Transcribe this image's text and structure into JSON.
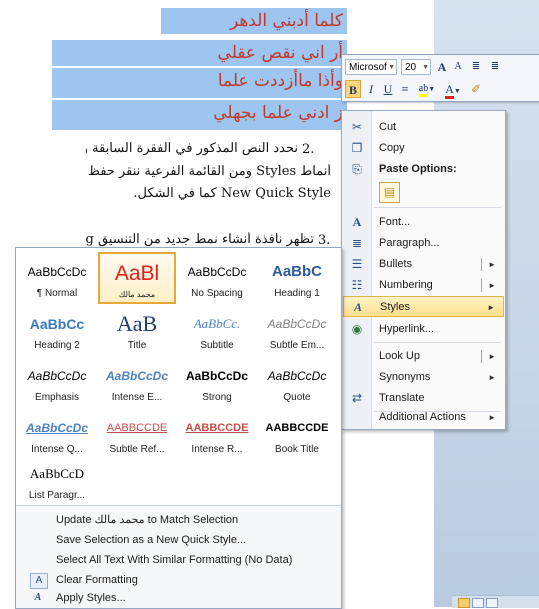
{
  "document": {
    "highlighted_lines": [
      "كلما أدبني الدهر",
      "أر اني نقص عقلي",
      "وأذا ماأزددت علما",
      "ز ادني علما بجهلي"
    ],
    "paragraph2": {
      "number": "2.",
      "line1": "نحدد النص المذكور في الفقرة السابقة وننقر بز",
      "line2": "أنماط Styles ومن القائمة الفرعية ننقر حفظ",
      "line3": "New Quick Style كما في الشكل."
    },
    "paragraph3": {
      "number": "3.",
      "line1": "تظهر نافذة أنشاء نمط جديد من التنسيق ting"
    }
  },
  "mini_toolbar": {
    "font_name": "Microsof",
    "font_size": "20",
    "grow_font": "A",
    "shrink_font": "A",
    "bold": "B",
    "italic": "I",
    "underline": "U",
    "center": "≡",
    "highlight": "ab",
    "font_color": "A",
    "format_painter": "✐"
  },
  "context_menu": {
    "items": [
      {
        "label": "Cut",
        "icon": "scissors-icon",
        "glyph": "✂"
      },
      {
        "label": "Copy",
        "icon": "copy-icon",
        "glyph": "❐"
      },
      {
        "label": "Font...",
        "icon": "font-icon",
        "glyph": "A"
      },
      {
        "label": "Paragraph...",
        "icon": "paragraph-icon",
        "glyph": "≣"
      },
      {
        "label": "Bullets",
        "icon": "bullets-icon",
        "glyph": "☰"
      },
      {
        "label": "Numbering",
        "icon": "numbering-icon",
        "glyph": "☷"
      },
      {
        "label": "Styles",
        "icon": "styles-icon",
        "glyph": "A"
      },
      {
        "label": "Hyperlink...",
        "icon": "hyperlink-icon",
        "glyph": "◉"
      },
      {
        "label": "Look Up",
        "icon": "",
        "glyph": ""
      },
      {
        "label": "Synonyms",
        "icon": "",
        "glyph": ""
      },
      {
        "label": "Translate",
        "icon": "translate-icon",
        "glyph": "⇄"
      },
      {
        "label": "Additional Actions",
        "icon": "",
        "glyph": ""
      }
    ],
    "paste_options_header": "Paste Options:",
    "paste_glyph": "📋",
    "submenu_arrow": "►",
    "highlight_color": "#ffe08a"
  },
  "styles_gallery": {
    "tiles": [
      {
        "preview": "AaBbCcDc",
        "name": "¶ Normal"
      },
      {
        "preview": "AaBl",
        "name": "محمد مالك"
      },
      {
        "preview": "AaBbCcDc",
        "name": "No Spacing"
      },
      {
        "preview": "AaBbC",
        "name": "Heading 1"
      },
      {
        "preview": "AaBbCc",
        "name": "Heading 2"
      },
      {
        "preview": "AaB",
        "name": "Title"
      },
      {
        "preview": "AaBbCc.",
        "name": "Subtitle"
      },
      {
        "preview": "AaBbCcDc",
        "name": "Subtle Em..."
      },
      {
        "preview": "AaBbCcDc",
        "name": "Emphasis"
      },
      {
        "preview": "AaBbCcDc",
        "name": "Intense E..."
      },
      {
        "preview": "AaBbCcDc",
        "name": "Strong"
      },
      {
        "preview": "AaBbCcDc",
        "name": "Quote"
      },
      {
        "preview": "AaBbCcDc",
        "name": "Intense Q..."
      },
      {
        "preview": "AABBCCDE",
        "name": "Subtle Ref..."
      },
      {
        "preview": "AABBCCDE",
        "name": "Intense R..."
      },
      {
        "preview": "AABBCCDE",
        "name": "Book Title"
      },
      {
        "preview": "AaBbCcD",
        "name": "List Paragr..."
      }
    ],
    "selected_index": 1,
    "actions": [
      {
        "label": "Update محمد مالك to Match Selection",
        "glyph": ""
      },
      {
        "label": "Save Selection as a New Quick Style...",
        "glyph": ""
      },
      {
        "label": "Select All Text With Similar Formatting (No Data)",
        "glyph": ""
      },
      {
        "label": "Clear Formatting",
        "glyph": "A"
      },
      {
        "label": "Apply Styles...",
        "glyph": "A"
      }
    ]
  },
  "colors": {
    "highlight_bg": "#9ec5f0",
    "highlight_text": "#c0392b",
    "selected_tile_border": "#e8a73a",
    "heading_blue": "#2e5c99"
  }
}
